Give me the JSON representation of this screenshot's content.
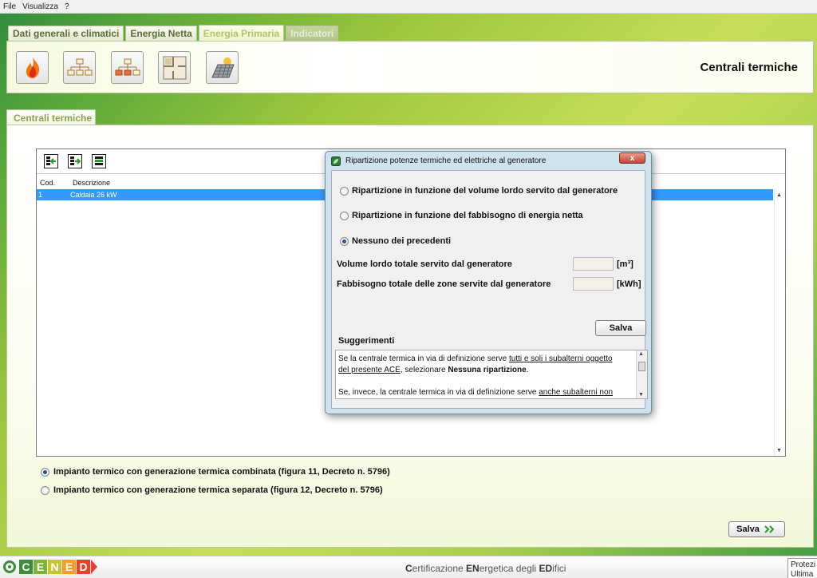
{
  "menu": [
    "File",
    "Visualizza",
    "?"
  ],
  "main_tabs": [
    {
      "label": "Dati generali e climatici",
      "state": "normal"
    },
    {
      "label": "Energia Netta",
      "state": "normal"
    },
    {
      "label": "Energia Primaria",
      "state": "active"
    },
    {
      "label": "Indicatori",
      "state": "disabled"
    }
  ],
  "header": {
    "title": "Centrali termiche",
    "icons": [
      "flame-icon",
      "network-diagram-icon",
      "network-diagram-highlighted-icon",
      "floor-plan-icon",
      "solar-panel-icon"
    ]
  },
  "sub_tab": "Centrali termiche",
  "list": {
    "columns": [
      "Cod.",
      "Descrizione"
    ],
    "rows": [
      {
        "code": "1",
        "description": "Caldaia 26 kW"
      }
    ]
  },
  "options": {
    "combined": "Impianto termico con generazione termica combinata (figura 11, Decreto n. 5796)",
    "separate": "Impianto termico con generazione termica separata (figura 12, Decreto n. 5796)",
    "selected": "combined"
  },
  "save_label": "Salva",
  "dialog": {
    "title": "Ripartizione potenze termiche ed elettriche al generatore",
    "close_label": "x",
    "radio_volume": "Ripartizione in funzione del volume lordo servito dal generatore",
    "radio_energy": "Ripartizione in funzione del fabbisogno di energia netta",
    "radio_none": "Nessuno dei precedenti",
    "selected": "none",
    "volume_label": "Volume lordo totale servito dal generatore",
    "volume_unit": "[m³]",
    "volume_value": "",
    "need_label": "Fabbisogno totale delle zone servite dal generatore",
    "need_unit": "[kWh]",
    "need_value": "",
    "save_label": "Salva",
    "suggestions_title": "Suggerimenti",
    "sugg_p1_a": "Se la centrale termica in via di definizione serve ",
    "sugg_p1_u1": "tutti e soli i subalterni oggetto",
    "sugg_p1_u2": "del presente ACE",
    "sugg_p1_b": ", selezionare ",
    "sugg_p1_bold": "Nessuna ripartizione",
    "sugg_p1_c": ".",
    "sugg_p2_a": "Se, invece, la centrale termica in via di definizione serve ",
    "sugg_p2_u": "anche subalterni non"
  },
  "footer": {
    "logo_letters": [
      "C",
      "E",
      "N",
      "E",
      "D"
    ],
    "logo_colors": [
      "#3d8c3a",
      "#78b53a",
      "#c8c32f",
      "#f0a02a",
      "#e8412b"
    ],
    "title_parts": [
      {
        "text": "C",
        "bold": true
      },
      {
        "text": "ertificazione ",
        "bold": false
      },
      {
        "text": "EN",
        "bold": true
      },
      {
        "text": "ergetica degli ",
        "bold": false
      },
      {
        "text": "ED",
        "bold": true
      },
      {
        "text": "ifici",
        "bold": false
      }
    ],
    "corner_line1": "Protezi",
    "corner_line2": "Ultima"
  }
}
